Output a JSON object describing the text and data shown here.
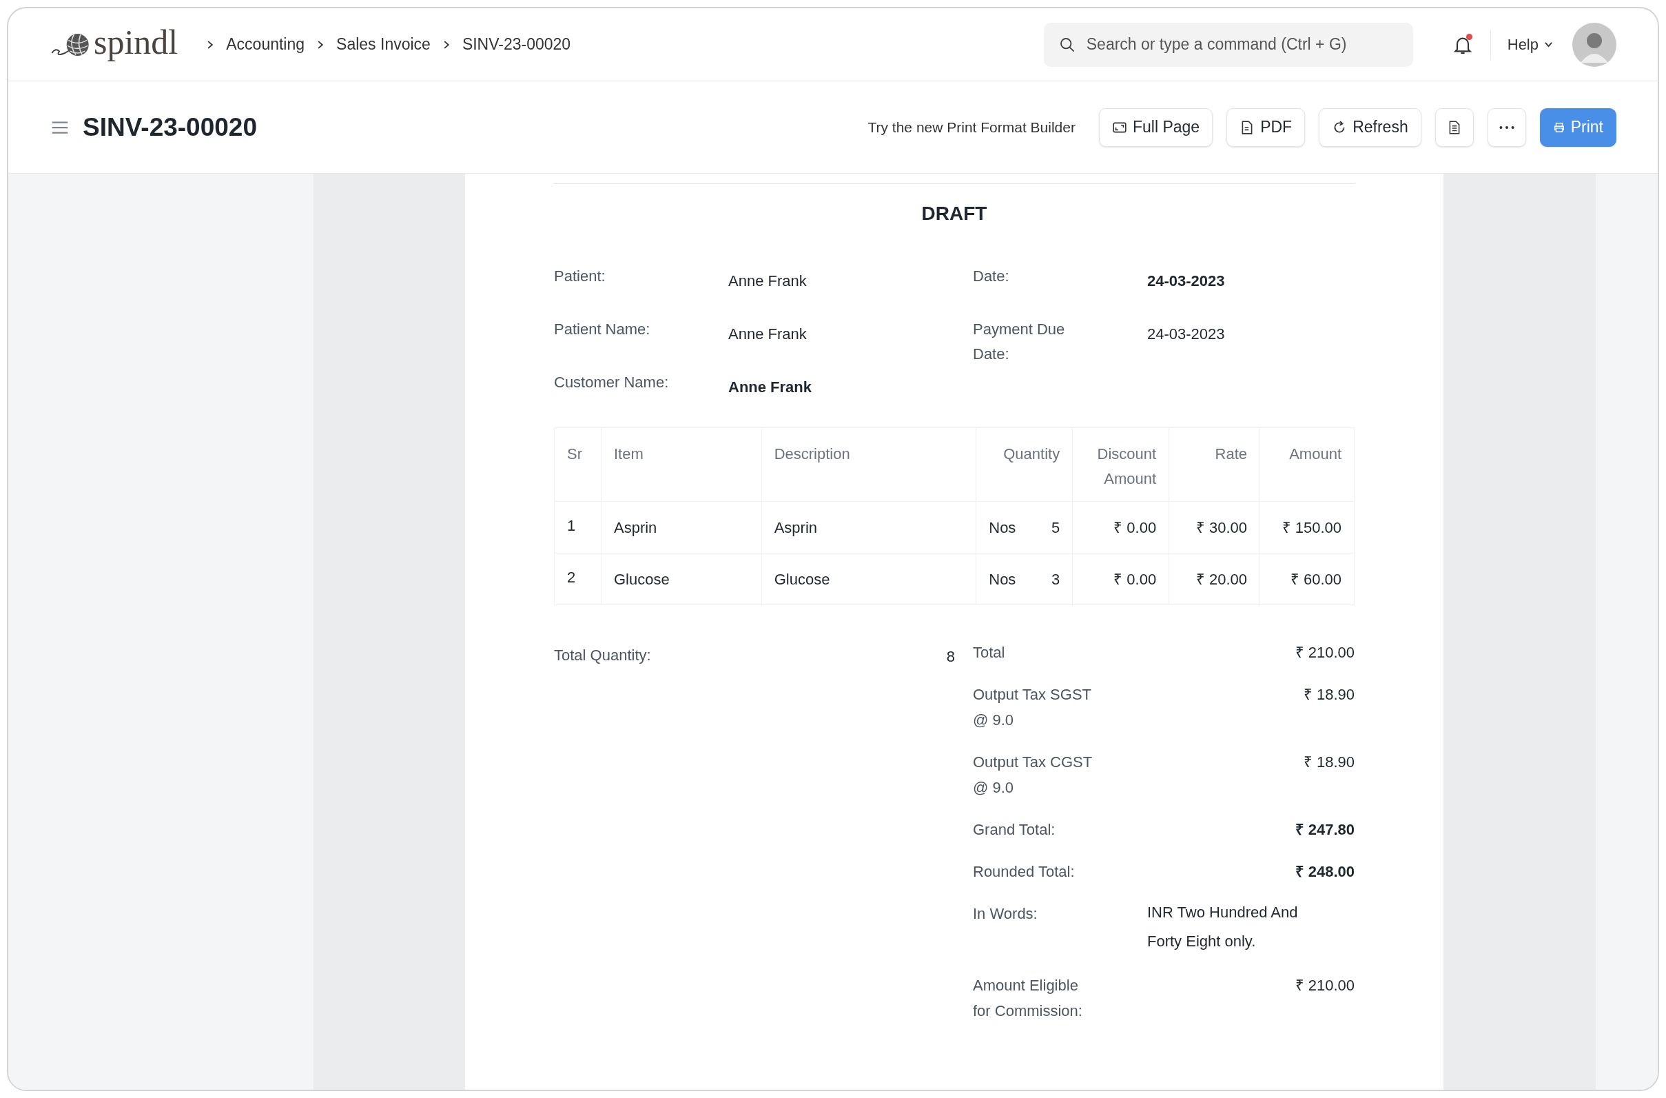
{
  "brand": "spindl",
  "breadcrumbs": [
    "Accounting",
    "Sales Invoice",
    "SINV-23-00020"
  ],
  "search": {
    "placeholder": "Search or type a command (Ctrl + G)"
  },
  "notifications": {
    "unread": true
  },
  "help": "Help",
  "title": "SINV-23-00020",
  "toolbar": {
    "hint": "Try the new Print Format Builder",
    "buttons": [
      {
        "kind": "full-page",
        "label": "Full Page"
      },
      {
        "kind": "pdf",
        "label": "PDF"
      },
      {
        "kind": "refresh",
        "label": "Refresh"
      },
      {
        "kind": "doc"
      },
      {
        "kind": "more"
      },
      {
        "kind": "print",
        "label": "Print"
      }
    ]
  },
  "invoice": {
    "status": "DRAFT",
    "left_fields": [
      {
        "label": "Patient:",
        "value": "Anne Frank",
        "bold": false
      },
      {
        "label": "Patient Name:",
        "value": "Anne Frank",
        "bold": false
      },
      {
        "label": "Customer Name:",
        "value": "Anne Frank",
        "bold": true
      }
    ],
    "right_fields": [
      {
        "label": "Date:",
        "value": "24-03-2023",
        "bold": true
      },
      {
        "label": "Payment Due Date:",
        "value": "24-03-2023",
        "bold": false
      }
    ],
    "table": {
      "columns": [
        "Sr",
        "Item",
        "Description",
        "Quantity",
        "Discount Amount",
        "Rate",
        "Amount"
      ],
      "rows": [
        {
          "sr": "1",
          "item": "Asprin",
          "description": "Asprin",
          "uom": "Nos",
          "qty": "5",
          "discount": "₹ 0.00",
          "rate": "₹ 30.00",
          "amount": "₹ 150.00"
        },
        {
          "sr": "2",
          "item": "Glucose",
          "description": "Glucose",
          "uom": "Nos",
          "qty": "3",
          "discount": "₹ 0.00",
          "rate": "₹ 20.00",
          "amount": "₹ 60.00"
        }
      ]
    },
    "total_quantity": {
      "label": "Total Quantity:",
      "value": "8"
    },
    "totals": [
      {
        "kind": "amount",
        "label": "Total",
        "value": "₹ 210.00",
        "bold": false
      },
      {
        "kind": "amount",
        "label": "Output Tax SGST @ 9.0",
        "value": "₹ 18.90",
        "bold": false
      },
      {
        "kind": "amount",
        "label": "Output Tax CGST @ 9.0",
        "value": "₹ 18.90",
        "bold": false
      },
      {
        "kind": "amount",
        "label": "Grand Total:",
        "value": "₹ 247.80",
        "bold": true
      },
      {
        "kind": "amount",
        "label": "Rounded Total:",
        "value": "₹ 248.00",
        "bold": true
      },
      {
        "kind": "words",
        "label": "In Words:",
        "value": "INR Two Hundred And Forty Eight only.",
        "bold": false
      },
      {
        "kind": "amount",
        "label": "Amount Eligible for Commission:",
        "value": "₹ 210.00",
        "bold": false
      }
    ]
  }
}
